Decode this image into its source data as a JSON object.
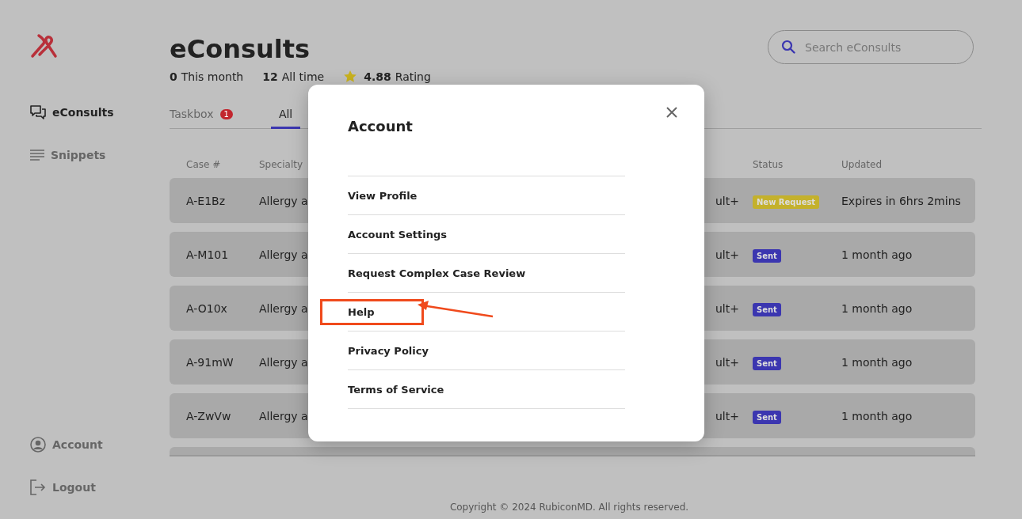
{
  "sidebar": {
    "items": [
      {
        "label": "eConsults",
        "selected": true
      },
      {
        "label": "Snippets",
        "selected": false
      }
    ],
    "bottom_items": [
      {
        "label": "Account"
      },
      {
        "label": "Logout"
      }
    ]
  },
  "header": {
    "title": "eConsults",
    "stats": [
      {
        "count": "0",
        "caption": "This month"
      },
      {
        "count": "12",
        "caption": "All time"
      }
    ],
    "rating": {
      "score": "4.88",
      "caption": "Rating"
    }
  },
  "search": {
    "placeholder": "Search eConsults"
  },
  "tabs": [
    {
      "label": "Taskbox",
      "badge": "1",
      "selected": false
    },
    {
      "label": "All",
      "selected": true
    }
  ],
  "table": {
    "columns": [
      "Case #",
      "Specialty",
      "Status",
      "Updated"
    ],
    "rows": [
      {
        "case": "A-E1Bz",
        "specialty": "Allergy a",
        "column_3": "ult+",
        "status": {
          "label": "New Request",
          "kind": "new"
        },
        "updated": "Expires in 6hrs 2mins"
      },
      {
        "case": "A-M101",
        "specialty": "Allergy a",
        "column_3": "ult+",
        "status": {
          "label": "Sent",
          "kind": "sent"
        },
        "updated": "1 month ago"
      },
      {
        "case": "A-O10x",
        "specialty": "Allergy a",
        "column_3": "ult+",
        "status": {
          "label": "Sent",
          "kind": "sent"
        },
        "updated": "1 month ago"
      },
      {
        "case": "A-91mW",
        "specialty": "Allergy a",
        "column_3": "ult+",
        "status": {
          "label": "Sent",
          "kind": "sent"
        },
        "updated": "1 month ago"
      },
      {
        "case": "A-ZwVw",
        "specialty": "Allergy a",
        "column_3": "ult+",
        "status": {
          "label": "Sent",
          "kind": "sent"
        },
        "updated": "1 month ago"
      }
    ]
  },
  "footer": "Copyright © 2024 RubiconMD. All rights reserved.",
  "modal": {
    "title": "Account",
    "items": [
      {
        "label": "View Profile",
        "highlighted": false
      },
      {
        "label": "Account Settings",
        "highlighted": false
      },
      {
        "label": "Request Complex Case Review",
        "highlighted": false
      },
      {
        "label": "Help",
        "highlighted": true
      },
      {
        "label": "Privacy Policy",
        "highlighted": false
      },
      {
        "label": "Terms of Service",
        "highlighted": false
      }
    ]
  }
}
